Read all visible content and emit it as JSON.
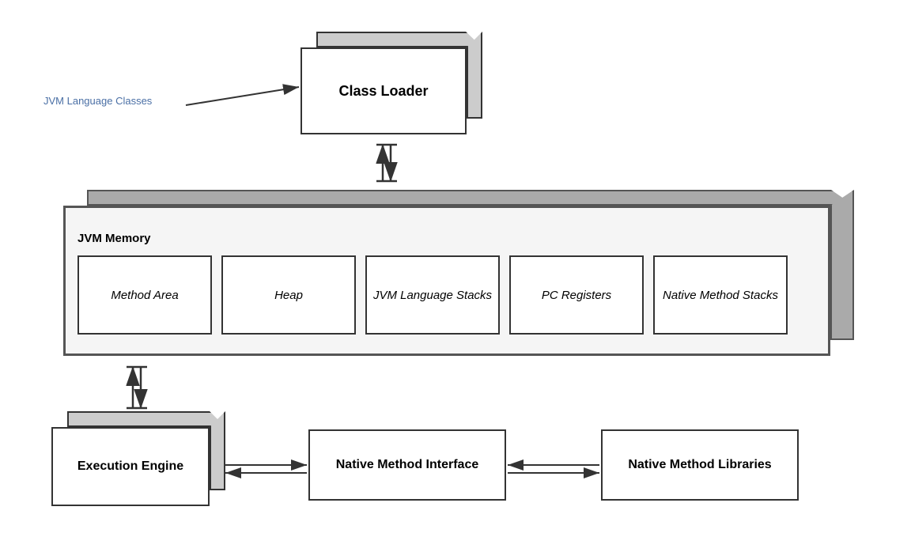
{
  "classLoader": {
    "label": "Class Loader"
  },
  "jvmLangClasses": {
    "label": "JVM Language Classes"
  },
  "jvmMemory": {
    "title": "JVM Memory",
    "boxes": [
      {
        "label": "Method Area"
      },
      {
        "label": "Heap"
      },
      {
        "label": "JVM Language Stacks"
      },
      {
        "label": "PC Registers"
      },
      {
        "label": "Native Method Stacks"
      }
    ]
  },
  "executionEngine": {
    "label": "Execution Engine"
  },
  "nativeMethodInterface": {
    "label": "Native Method Interface"
  },
  "nativeMethodLibraries": {
    "label": "Native Method Libraries"
  }
}
